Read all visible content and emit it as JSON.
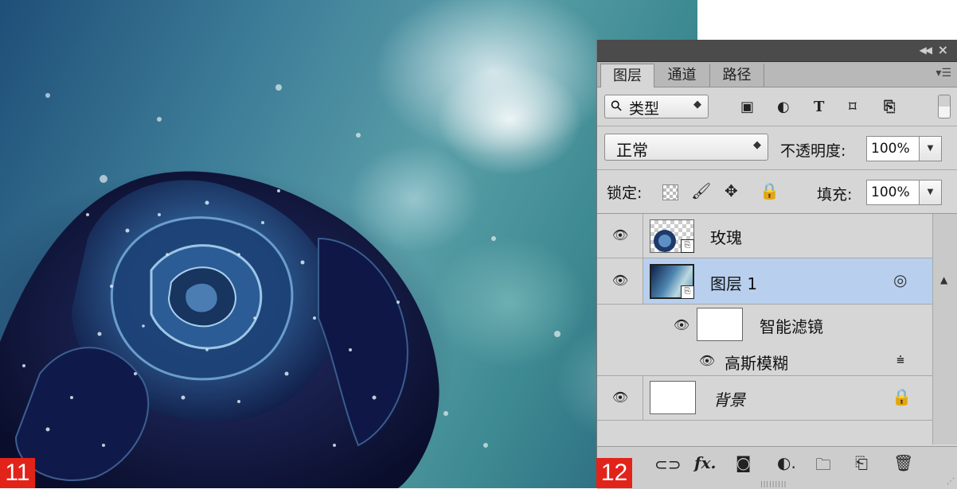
{
  "figure_labels": [
    "11",
    "12"
  ],
  "panel": {
    "tabs": [
      {
        "label": "图层",
        "active": true
      },
      {
        "label": "通道",
        "active": false
      },
      {
        "label": "路径",
        "active": false
      }
    ],
    "filter": {
      "label": "类型"
    },
    "blend_mode": "正常",
    "opacity": {
      "label": "不透明度:",
      "value": "100%"
    },
    "lock": {
      "label": "锁定:"
    },
    "fill": {
      "label": "填充:",
      "value": "100%"
    },
    "layers": [
      {
        "name": "玫瑰",
        "visible": true,
        "type": "smart-object"
      },
      {
        "name": "图层 1",
        "visible": true,
        "type": "smart-object",
        "selected": true
      },
      {
        "name": "背景",
        "visible": true,
        "type": "background",
        "locked": true
      }
    ],
    "smart_filter": {
      "label": "智能滤镜",
      "effect": "高斯模糊"
    }
  },
  "colors": {
    "selected_layer": "#b8d0ee",
    "badge": "#e2231a",
    "titlebar": "#4b4b4b"
  }
}
